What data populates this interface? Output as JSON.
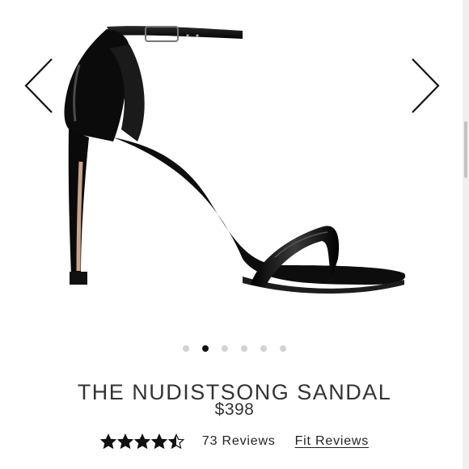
{
  "product": {
    "title": "THE NUDISTSONG SANDAL",
    "price": "$398",
    "rating": 4.5,
    "rating_max": 5,
    "reviews_label": "73 Reviews",
    "fit_reviews_label": "Fit Reviews"
  },
  "carousel": {
    "slide_count": 6,
    "active_index": 1,
    "prev_icon": "chevron-left-icon",
    "next_icon": "chevron-right-icon"
  },
  "colors": {
    "shoe": "#0d0d0d",
    "heel_accent": "#c9a58c",
    "dot_active": "#111111",
    "dot_inactive": "#d2d2d2"
  }
}
